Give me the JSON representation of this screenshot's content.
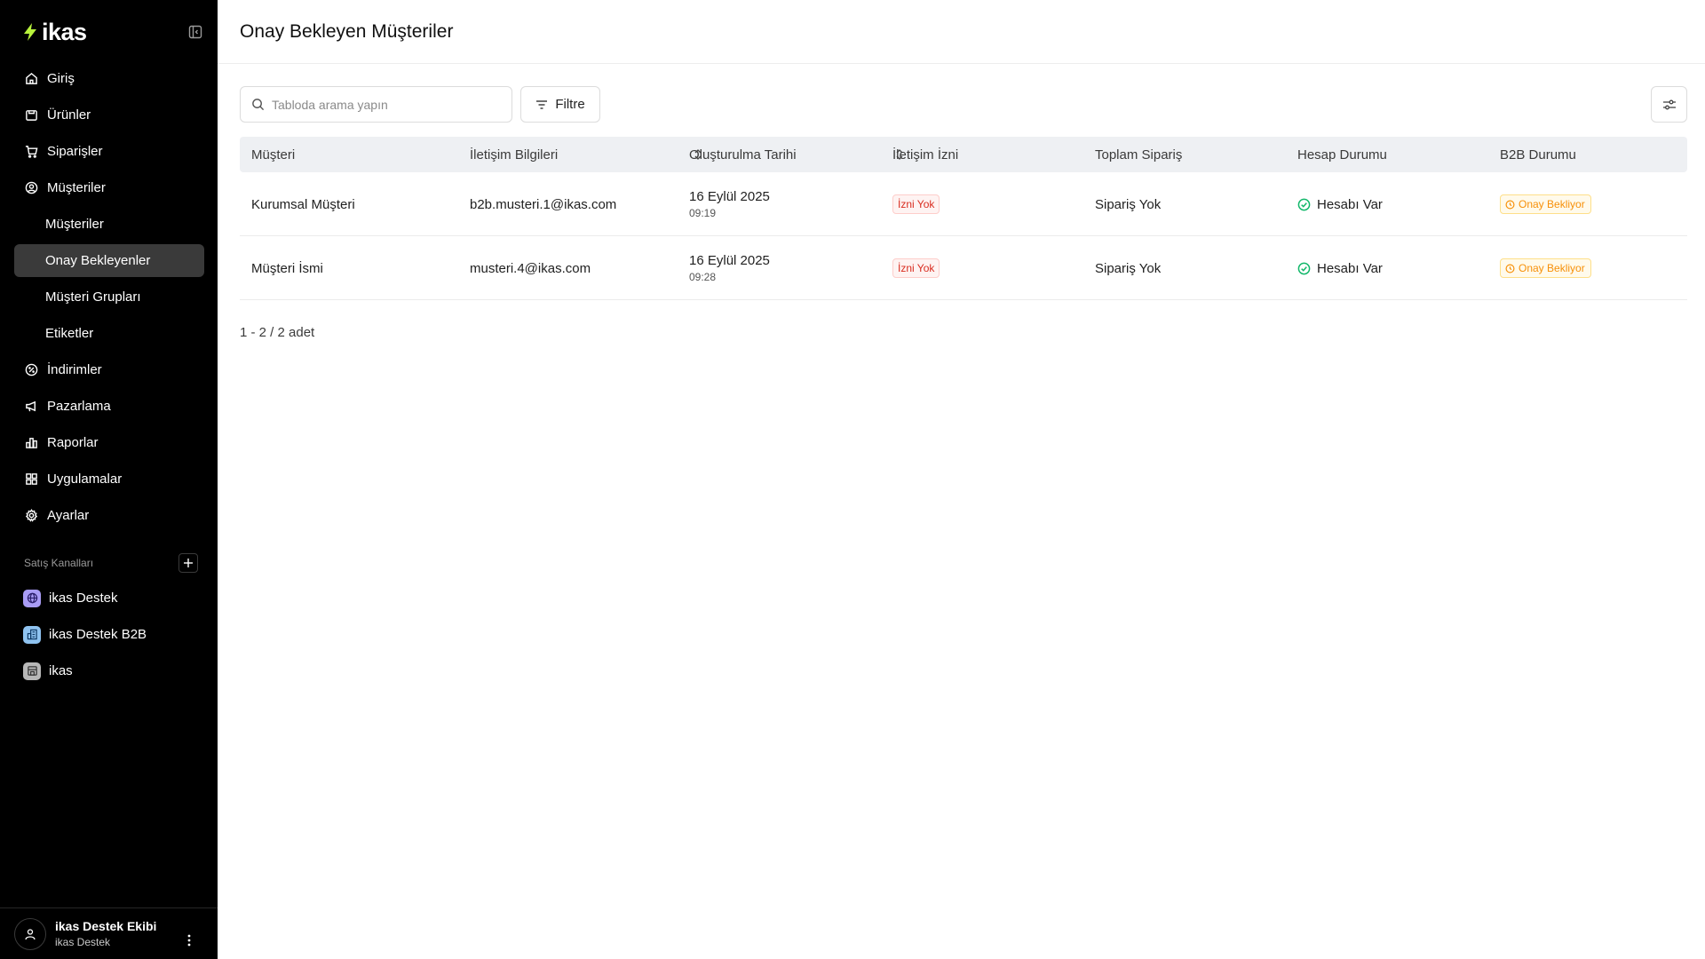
{
  "app": {
    "logo_text": "ikas",
    "brand_color": "#b8f23c"
  },
  "sidebar": {
    "items": [
      {
        "label": "Giriş",
        "icon": "home-icon"
      },
      {
        "label": "Ürünler",
        "icon": "box-icon"
      },
      {
        "label": "Siparişler",
        "icon": "cart-icon"
      },
      {
        "label": "Müşteriler",
        "icon": "user-circle-icon"
      },
      {
        "label": "Müşteriler",
        "icon": null,
        "sub": true
      },
      {
        "label": "Onay Bekleyenler",
        "icon": null,
        "sub": true,
        "active": true
      },
      {
        "label": "Müşteri Grupları",
        "icon": null,
        "sub": true
      },
      {
        "label": "Etiketler",
        "icon": null,
        "sub": true
      },
      {
        "label": "İndirimler",
        "icon": "discount-icon"
      },
      {
        "label": "Pazarlama",
        "icon": "megaphone-icon"
      },
      {
        "label": "Raporlar",
        "icon": "bar-chart-icon"
      },
      {
        "label": "Uygulamalar",
        "icon": "grid-icon"
      },
      {
        "label": "Ayarlar",
        "icon": "gear-icon"
      }
    ],
    "channels_title": "Satış Kanalları",
    "channels": [
      {
        "label": "ikas Destek",
        "icon": "globe-icon",
        "color": "#a99cf5"
      },
      {
        "label": "ikas Destek B2B",
        "icon": "building-icon",
        "color": "#8fc3f0"
      },
      {
        "label": "ikas",
        "icon": "store-icon",
        "color": "#b8b8b8"
      }
    ],
    "user": {
      "name": "ikas Destek Ekibi",
      "store": "ikas Destek"
    }
  },
  "main": {
    "title": "Onay Bekleyen Müşteriler",
    "search": {
      "placeholder": "Tabloda arama yapın",
      "value": ""
    },
    "filter_label": "Filtre",
    "table": {
      "columns": [
        "Müşteri",
        "İletişim Bilgileri",
        "Oluşturulma Tarihi",
        "İletişim İzni",
        "Toplam Sipariş",
        "Hesap Durumu",
        "B2B Durumu"
      ],
      "rows": [
        {
          "customer": "Kurumsal Müşteri",
          "contact": "b2b.musteri.1@ikas.com",
          "date": "16 Eylül 2025",
          "time": "09:19",
          "permission": "İzni Yok",
          "orders": "Sipariş Yok",
          "account": "Hesabı Var",
          "b2b": "Onay Bekliyor"
        },
        {
          "customer": "Müşteri İsmi",
          "contact": "musteri.4@ikas.com",
          "date": "16 Eylül 2025",
          "time": "09:28",
          "permission": "İzni Yok",
          "orders": "Sipariş Yok",
          "account": "Hesabı Var",
          "b2b": "Onay Bekliyor"
        }
      ]
    },
    "pagination": "1 - 2 / 2 adet"
  }
}
